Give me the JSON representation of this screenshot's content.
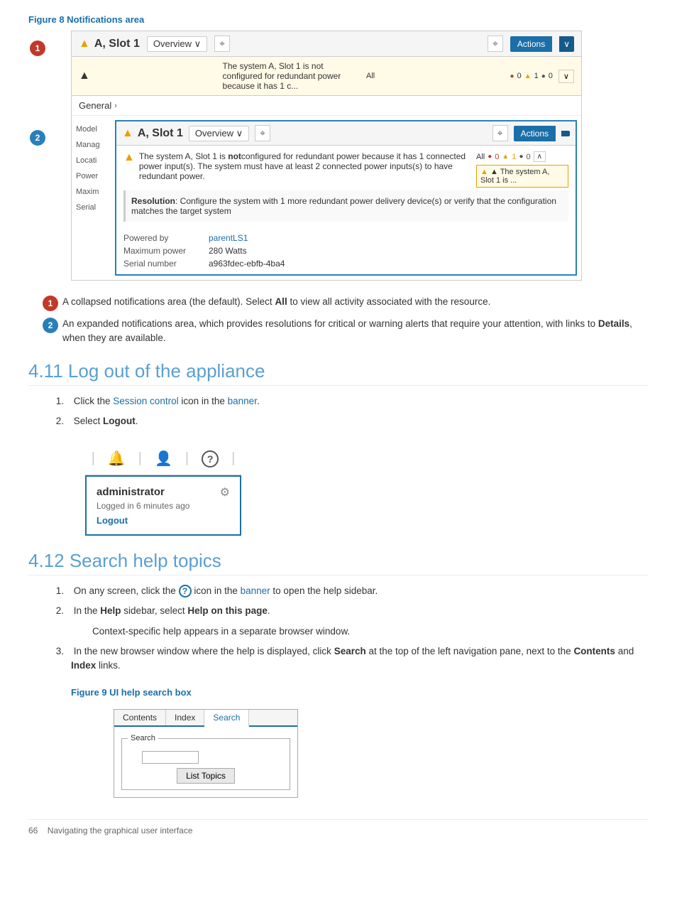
{
  "figure8": {
    "title": "Figure 8 Notifications area",
    "notif_bar": {
      "warning_icon": "▲",
      "slot_label": "A, Slot 1",
      "overview_label": "Overview ∨",
      "pin_icon": "⌖",
      "actions_label": "Actions",
      "caret": "∨"
    },
    "alert_row": {
      "text": "The system A, Slot 1 is not configured for redundant power because it has 1 c...",
      "all_label": "All",
      "counts": [
        "0",
        "1",
        "0"
      ],
      "chevron": "∨"
    },
    "general_label": "General",
    "general_arrow": "›",
    "sidebar_labels": [
      "Model",
      "Manag",
      "Locati",
      "Power",
      "Maxim",
      "Serial"
    ],
    "expanded": {
      "slot_label": "A, Slot 1",
      "overview_label": "Overview ∨",
      "pin_icon": "⌖",
      "actions_label": "Actions",
      "alert_text1": "▲ The system A, Slot 1 is notconfigured for redundant power because it has 1 connected power input(s). The system must have at least 2 connected power inputs(s) to have redundant power.",
      "all_label": "All",
      "counts": [
        "0",
        "1",
        "0"
      ],
      "slot_ref": "▲ The system A, Slot 1 is ...",
      "resolution_title": "Resolution",
      "resolution_text": ": Configure the system with 1 more redundant power delivery device(s) or verify that the configuration matches the target system"
    },
    "props": {
      "powered_by_label": "Powered by",
      "powered_by_value": "parentLS1",
      "max_power_label": "Maximum power",
      "max_power_value": "280 Watts",
      "serial_label": "Serial number",
      "serial_value": "a963fdec-ebfb-4ba4"
    }
  },
  "descriptions": [
    {
      "num": "1",
      "text": "A collapsed notifications area (the default). Select ",
      "bold": "All",
      "text2": " to view all activity associated with the resource."
    },
    {
      "num": "2",
      "text": "An expanded notifications area, which provides resolutions for critical or warning alerts that require your attention, with links to ",
      "bold": "Details",
      "text2": ", when they are available."
    }
  ],
  "section411": {
    "heading": "4.11 Log out of the appliance",
    "steps": [
      {
        "num": "1.",
        "prefix": "Click the ",
        "link": "Session control",
        "suffix": " icon in the ",
        "link2": "banner",
        "suffix2": "."
      },
      {
        "num": "2.",
        "text": "Select ",
        "bold": "Logout",
        "suffix": "."
      }
    ]
  },
  "logout_popup": {
    "admin_name": "administrator",
    "logged_in_text": "Logged in 6 minutes ago",
    "logout_label": "Logout"
  },
  "section412": {
    "heading": "4.12 Search help topics",
    "steps": [
      {
        "num": "1.",
        "prefix": "On any screen, click the ",
        "icon_label": "?",
        "suffix": " icon in the ",
        "link": "banner",
        "suffix2": " to open the help sidebar."
      },
      {
        "num": "2.",
        "prefix": "In the ",
        "bold1": "Help",
        "middle": " sidebar, select ",
        "bold2": "Help on this page",
        "suffix": "."
      },
      {
        "num": "",
        "text": "Context-specific help appears in a separate browser window."
      },
      {
        "num": "3.",
        "prefix": "In the new browser window where the help is displayed, click ",
        "bold": "Search",
        "middle": " at the top of the left navigation pane, next to the ",
        "bold2": "Contents",
        "and": " and ",
        "bold3": "Index",
        "suffix": " links."
      }
    ]
  },
  "figure9": {
    "title": "Figure 9 UI help search box",
    "tabs": [
      "Contents",
      "Index",
      "Search"
    ],
    "active_tab": "Search",
    "search_group_label": "Search",
    "list_topics_btn": "List Topics"
  },
  "footer": {
    "page_num": "66",
    "page_text": "Navigating the graphical user interface"
  }
}
